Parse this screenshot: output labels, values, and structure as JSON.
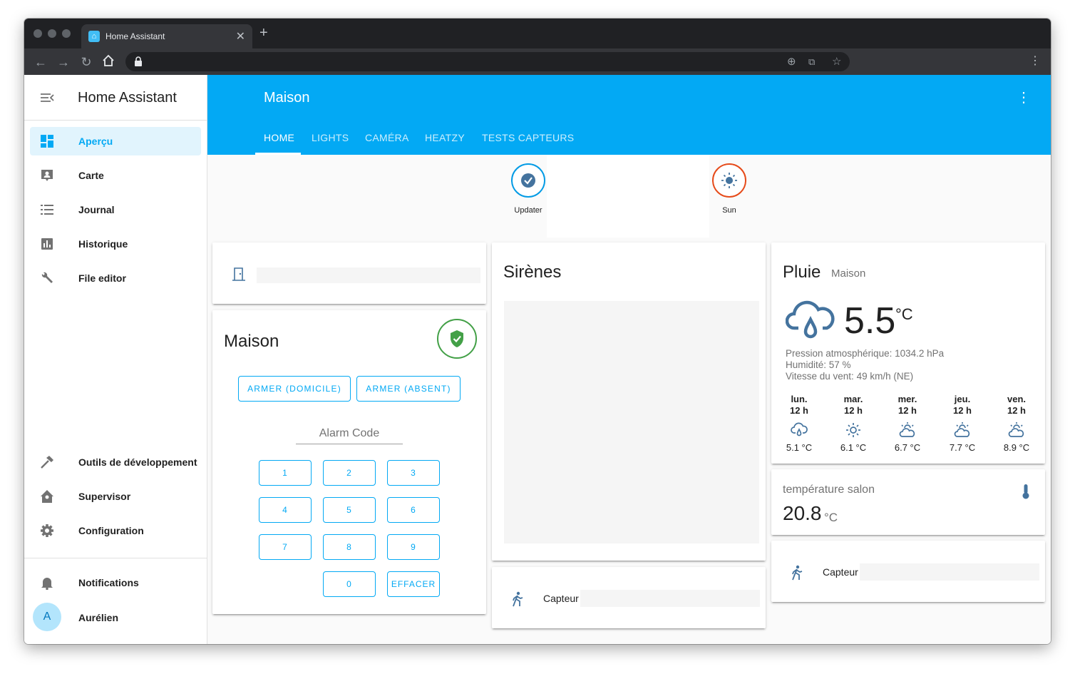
{
  "browser": {
    "tab_title": "Home Assistant",
    "close_glyph": "✕",
    "new_tab_glyph": "+",
    "menu_glyph": "⋮"
  },
  "sidebar": {
    "title": "Home Assistant",
    "items": [
      {
        "label": "Aperçu",
        "icon": "dashboard-icon"
      },
      {
        "label": "Carte",
        "icon": "map-icon"
      },
      {
        "label": "Journal",
        "icon": "list-icon"
      },
      {
        "label": "Historique",
        "icon": "chart-icon"
      },
      {
        "label": "File editor",
        "icon": "wrench-icon"
      }
    ],
    "tools": [
      {
        "label": "Outils de développement",
        "icon": "hammer-icon"
      },
      {
        "label": "Supervisor",
        "icon": "home-assistant-icon"
      },
      {
        "label": "Configuration",
        "icon": "gear-icon"
      }
    ],
    "notifications_label": "Notifications",
    "user_initial": "A",
    "user_name": "Aurélien"
  },
  "header": {
    "title": "Maison",
    "menu_glyph": "⋮",
    "tabs": [
      "HOME",
      "LIGHTS",
      "CAMÉRA",
      "HEATZY",
      "TESTS CAPTEURS"
    ],
    "active_tab": "HOME"
  },
  "badges": [
    {
      "label": "Updater",
      "icon": "check-circle-icon",
      "color": "#039be5"
    },
    {
      "label": "Sun",
      "icon": "sun-icon",
      "color": "#e64a19"
    }
  ],
  "alarm": {
    "title": "Maison",
    "state_color": "#43a047",
    "arm_home": "ARMER (DOMICILE)",
    "arm_away": "ARMER (ABSENT)",
    "code_placeholder": "Alarm Code",
    "keys": [
      "1",
      "2",
      "3",
      "4",
      "5",
      "6",
      "7",
      "8",
      "9",
      "0",
      "EFFACER"
    ]
  },
  "sirenes": {
    "title": "Sirènes",
    "entity": "Capteur"
  },
  "weather": {
    "title": "Pluie",
    "subtitle": "Maison",
    "temperature": "5.5",
    "unit": "°C",
    "attributes": [
      "Pression atmosphérique: 1034.2 hPa",
      "Humidité: 57 %",
      "Vitesse du vent: 49 km/h (NE)"
    ],
    "forecast": [
      {
        "day": "lun.",
        "hour": "12 h",
        "temp": "5.1 °C",
        "icon": "rain-icon"
      },
      {
        "day": "mar.",
        "hour": "12 h",
        "temp": "6.1 °C",
        "icon": "sun-icon"
      },
      {
        "day": "mer.",
        "hour": "12 h",
        "temp": "6.7 °C",
        "icon": "partly-cloudy-icon"
      },
      {
        "day": "jeu.",
        "hour": "12 h",
        "temp": "7.7 °C",
        "icon": "partly-cloudy-icon"
      },
      {
        "day": "ven.",
        "hour": "12 h",
        "temp": "8.9 °C",
        "icon": "partly-cloudy-icon"
      }
    ]
  },
  "temperature_salon": {
    "name": "température salon",
    "value": "20.8",
    "unit": "°C"
  },
  "motion_right": {
    "entity": "Capteur"
  },
  "colors": {
    "primary": "#03a9f4",
    "icon": "#44739e",
    "sidebar_active_bg": "#e1f4fd"
  }
}
